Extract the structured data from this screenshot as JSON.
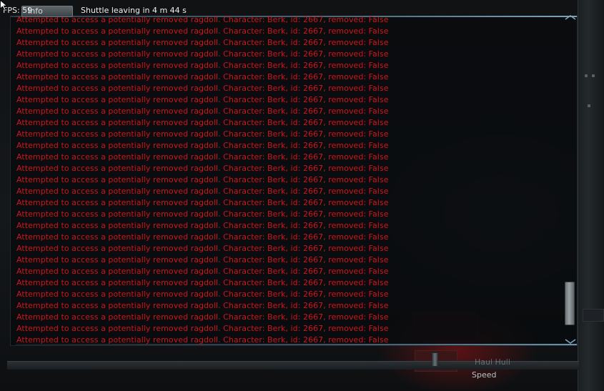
{
  "hud": {
    "fps_label": "FPS: 59",
    "info_button_label": "Info",
    "shuttle_status": "Shuttle leaving in 4 m 44 s",
    "speed_label": "Speed",
    "speed_ghost_label": "Haul Hull"
  },
  "console": {
    "text_color": "#d4141a",
    "lines": [
      "Attempted to access a potentially removed ragdoll. Character: Berk, id: 2667, removed: False",
      "Attempted to access a potentially removed ragdoll. Character: Berk, id: 2667, removed: False",
      "Attempted to access a potentially removed ragdoll. Character: Berk, id: 2667, removed: False",
      "Attempted to access a potentially removed ragdoll. Character: Berk, id: 2667, removed: False",
      "Attempted to access a potentially removed ragdoll. Character: Berk, id: 2667, removed: False",
      "Attempted to access a potentially removed ragdoll. Character: Berk, id: 2667, removed: False",
      "Attempted to access a potentially removed ragdoll. Character: Berk, id: 2667, removed: False",
      "Attempted to access a potentially removed ragdoll. Character: Berk, id: 2667, removed: False",
      "Attempted to access a potentially removed ragdoll. Character: Berk, id: 2667, removed: False",
      "Attempted to access a potentially removed ragdoll. Character: Berk, id: 2667, removed: False",
      "Attempted to access a potentially removed ragdoll. Character: Berk, id: 2667, removed: False",
      "Attempted to access a potentially removed ragdoll. Character: Berk, id: 2667, removed: False",
      "Attempted to access a potentially removed ragdoll. Character: Berk, id: 2667, removed: False",
      "Attempted to access a potentially removed ragdoll. Character: Berk, id: 2667, removed: False",
      "Attempted to access a potentially removed ragdoll. Character: Berk, id: 2667, removed: False",
      "Attempted to access a potentially removed ragdoll. Character: Berk, id: 2667, removed: False",
      "Attempted to access a potentially removed ragdoll. Character: Berk, id: 2667, removed: False",
      "Attempted to access a potentially removed ragdoll. Character: Berk, id: 2667, removed: False",
      "Attempted to access a potentially removed ragdoll. Character: Berk, id: 2667, removed: False",
      "Attempted to access a potentially removed ragdoll. Character: Berk, id: 2667, removed: False",
      "Attempted to access a potentially removed ragdoll. Character: Berk, id: 2667, removed: False",
      "Attempted to access a potentially removed ragdoll. Character: Berk, id: 2667, removed: False",
      "Attempted to access a potentially removed ragdoll. Character: Berk, id: 2667, removed: False",
      "Attempted to access a potentially removed ragdoll. Character: Berk, id: 2667, removed: False",
      "Attempted to access a potentially removed ragdoll. Character: Berk, id: 2667, removed: False",
      "Attempted to access a potentially removed ragdoll. Character: Berk, id: 2667, removed: False",
      "Attempted to access a potentially removed ragdoll. Character: Berk, id: 2667, removed: False",
      "Attempted to access a potentially removed ragdoll. Character: Berk, id: 2667, removed: False",
      "Attempted to access a potentially removed ragdoll. Character: Berk, id: 2667, removed: False"
    ],
    "scroll_position_fraction": 0.95
  },
  "icons": {
    "cursor": "arrow-cursor-icon",
    "scroll_up": "chevron-up-icon",
    "scroll_down": "chevron-down-icon"
  }
}
